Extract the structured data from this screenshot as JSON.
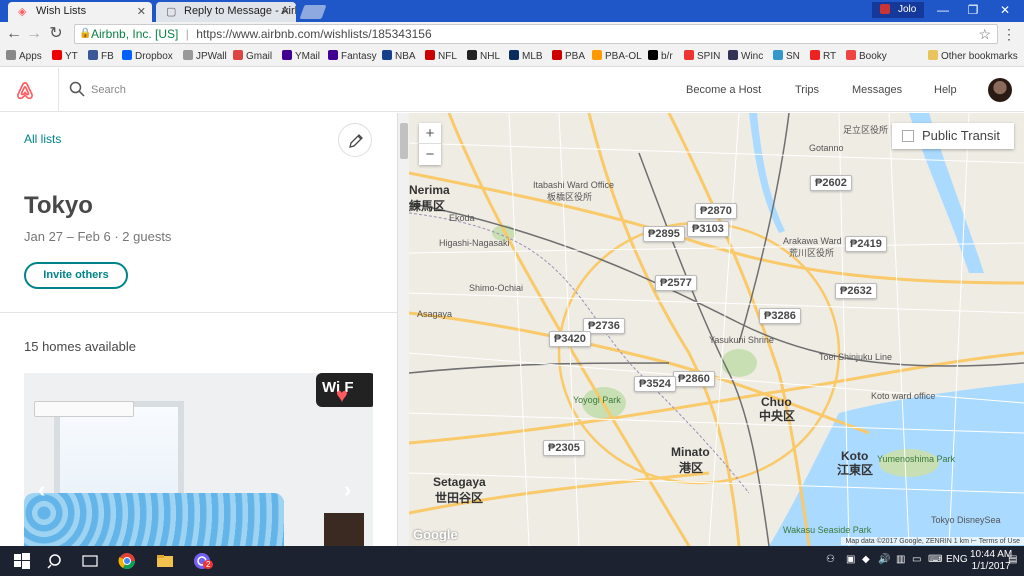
{
  "browser": {
    "tabs": [
      {
        "label": "Wish Lists",
        "active": true
      },
      {
        "label": "Reply to Message - Airb",
        "active": false
      }
    ],
    "profile_name": "Jolo",
    "url_secure_label": "Airbnb, Inc. [US]",
    "url": "https://www.airbnb.com/wishlists/185343156",
    "bookmarks": [
      "Apps",
      "YT",
      "FB",
      "Dropbox",
      "JPWall",
      "Gmail",
      "YMail",
      "Fantasy",
      "NBA",
      "NFL",
      "NHL",
      "MLB",
      "PBA",
      "PBA-OL",
      "b/r",
      "SPIN",
      "Winc",
      "SN",
      "RT",
      "Booky"
    ],
    "other_bookmarks": "Other bookmarks"
  },
  "header": {
    "search_placeholder": "Search",
    "nav": [
      "Become a Host",
      "Trips",
      "Messages",
      "Help"
    ]
  },
  "wishlist": {
    "back_link": "All lists",
    "title": "Tokyo",
    "subtitle": "Jan 27 – Feb 6 · 2 guests",
    "invite_label": "Invite others",
    "homes_count": "15 homes available",
    "photo_overlay_text": "Wi F",
    "prev_arrow": "‹",
    "next_arrow": "›"
  },
  "map": {
    "zoom_in": "+",
    "zoom_out": "−",
    "transit_label": "Public Transit",
    "prices": [
      "₱2602",
      "₱2870",
      "₱2895",
      "₱3103",
      "₱2419",
      "₱2577",
      "₱2632",
      "₱3286",
      "₱2736",
      "₱3420",
      "₱3524",
      "₱2860",
      "₱2305"
    ],
    "labels": {
      "nerima": "Nerima",
      "nerima_jp": "練馬区",
      "itabashi": "Itabashi Ward Office",
      "itabashi_jp": "板橋区役所",
      "arakawa": "Arakawa Ward",
      "arakawa_jp": "荒川区役所",
      "chuo": "Chuo",
      "chuo_jp": "中央区",
      "minato": "Minato",
      "minato_jp": "港区",
      "setagaya": "Setagaya",
      "setagaya_jp": "世田谷区",
      "koto": "Koto",
      "koto_jp": "江東区",
      "koto_office": "Koto ward office",
      "yoyogi": "Yoyogi Park",
      "yasukuni": "Yasukuni Shrine",
      "toei": "Toei Shinjuku Line",
      "yumenoshima": "Yumenoshima Park",
      "disneysea": "Tokyo DisneySea",
      "wakasu": "Wakasu Seaside Park",
      "adachi": "足立区役所",
      "higashi_nagasaki": "Higashi-Nagasaki",
      "shimo_ochiai": "Shimo-Ochiai",
      "asagaya": "Asagaya",
      "ekoda": "Ekoda",
      "gotanno": "Gotanno"
    },
    "google": "Google",
    "attribution": "Map data ©2017 Google, ZENRIN  1 km ⊢  Terms of Use"
  },
  "taskbar": {
    "lang": "ENG",
    "time": "10:44 AM",
    "date": "1/1/2017",
    "badge": "2"
  },
  "colors": {
    "brand": "#ff5a5f",
    "teal": "#008489",
    "titlebar": "#1f57c8",
    "taskbar": "#1c2230"
  }
}
